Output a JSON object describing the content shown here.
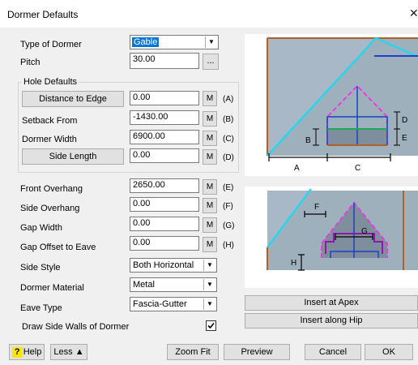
{
  "window": {
    "title": "Dormer Defaults",
    "close_glyph": "✕"
  },
  "form": {
    "type_label": "Type of Dormer",
    "type_value": "Gable",
    "pitch_label": "Pitch",
    "pitch_value": "30.00",
    "pitch_button": "...",
    "hole_group_title": "Hole Defaults",
    "distance_button": "Distance to Edge",
    "distance_value": "0.00",
    "distance_tag": "(A)",
    "setback_label": "Setback From",
    "setback_value": "-1430.00",
    "setback_tag": "(B)",
    "width_label": "Dormer Width",
    "width_value": "6900.00",
    "width_tag": "(C)",
    "side_length_button": "Side Length",
    "side_length_value": "0.00",
    "side_length_tag": "(D)",
    "front_overhang_label": "Front Overhang",
    "front_overhang_value": "2650.00",
    "front_overhang_tag": "(E)",
    "side_overhang_label": "Side Overhang",
    "side_overhang_value": "0.00",
    "side_overhang_tag": "(F)",
    "gap_width_label": "Gap Width",
    "gap_width_value": "0.00",
    "gap_width_tag": "(G)",
    "gap_offset_label": "Gap Offset to Eave",
    "gap_offset_value": "0.00",
    "gap_offset_tag": "(H)",
    "side_style_label": "Side Style",
    "side_style_value": "Both Horizontal",
    "material_label": "Dormer Material",
    "material_value": "Metal",
    "eave_type_label": "Eave Type",
    "eave_type_value": "Fascia-Gutter",
    "draw_walls_label": "Draw Side Walls of Dormer",
    "draw_walls_checked": true,
    "m_label": "M"
  },
  "diagram": {
    "label_a": "A",
    "label_b": "B",
    "label_c": "C",
    "label_d": "D",
    "label_e": "E",
    "label_f": "F",
    "label_g": "G",
    "label_h": "H"
  },
  "buttons": {
    "insert_apex": "Insert at Apex",
    "insert_hip": "Insert along Hip",
    "help": "Help",
    "help_icon": "?",
    "less": "Less ▲",
    "zoom_fit": "Zoom Fit",
    "preview": "Preview",
    "cancel": "Cancel",
    "ok": "OK"
  }
}
